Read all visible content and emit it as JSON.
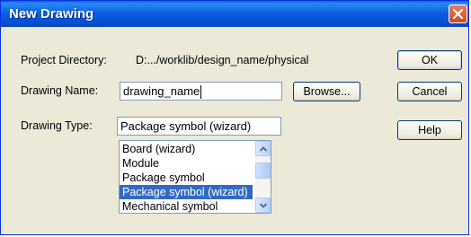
{
  "window": {
    "title": "New Drawing"
  },
  "project": {
    "label": "Project Directory:",
    "value": "D:.../worklib/design_name/physical"
  },
  "drawing_name": {
    "label": "Drawing Name:",
    "value": "drawing_name"
  },
  "drawing_type": {
    "label": "Drawing Type:",
    "value": "Package symbol (wizard)",
    "options": [
      "Board (wizard)",
      "Module",
      "Package symbol",
      "Package symbol (wizard)",
      "Mechanical symbol"
    ],
    "selected_index": 3
  },
  "buttons": {
    "ok": "OK",
    "cancel": "Cancel",
    "help": "Help",
    "browse": "Browse..."
  },
  "colors": {
    "titlebar": "#0a61e3",
    "selection": "#316ac5",
    "dialog_bg": "#ece9d8"
  },
  "icons": {
    "close": "close-icon",
    "scroll_up": "chevron-up-icon",
    "scroll_down": "chevron-down-icon"
  }
}
